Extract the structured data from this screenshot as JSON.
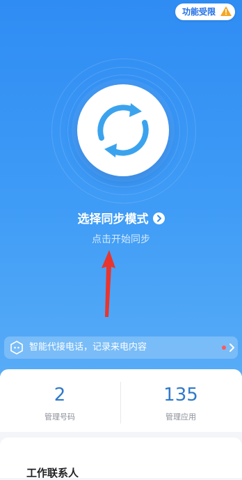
{
  "header": {
    "restricted_badge": "功能受限"
  },
  "sync": {
    "mode_label": "选择同步模式",
    "subtitle": "点击开始同步"
  },
  "banner": {
    "text": "智能代接电话，记录来电内容"
  },
  "stats": [
    {
      "value": "2",
      "label": "管理号码"
    },
    {
      "value": "135",
      "label": "管理应用"
    }
  ],
  "section": {
    "title": "工作联系人"
  },
  "colors": {
    "primary": "#2f8cf3",
    "accent": "#3ba3ee",
    "annotation_arrow": "#e8352e",
    "warning": "#f5a623",
    "stat_number": "#2f79c9"
  },
  "icons": {
    "warning": "warning-triangle-icon",
    "sync": "sync-icon",
    "chevron": "chevron-right-icon",
    "assistant": "robot-icon"
  }
}
